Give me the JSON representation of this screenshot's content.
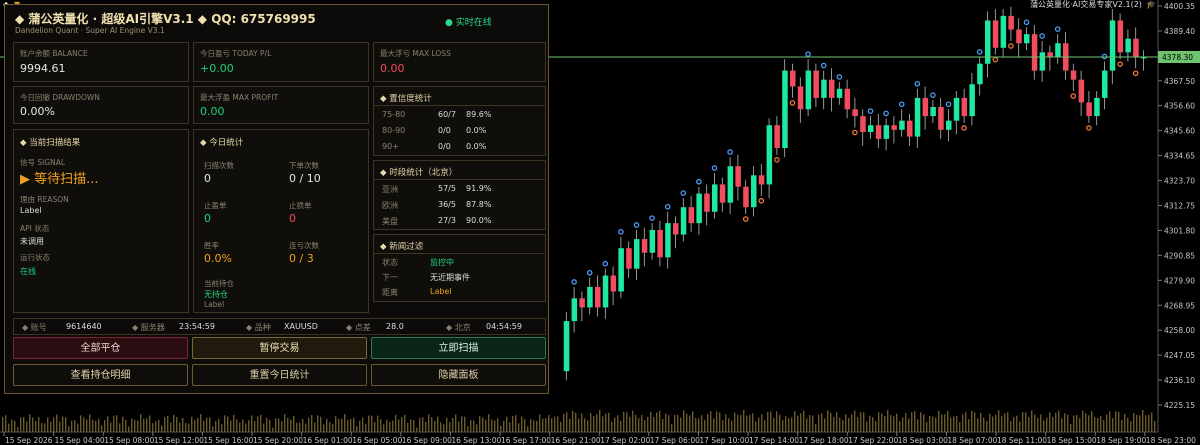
{
  "toolbar": {
    "icon1": "◆",
    "icon2": "🔒",
    "icon3": "▼",
    "icon4": "▣",
    "right_label": "蒲公英量化·AI交易专家V2.1(2)",
    "right_icon": "🎓"
  },
  "chart": {
    "price_labels": [
      "4400.35",
      "4389.40",
      "4378.30",
      "4367.50",
      "4356.60",
      "4345.60",
      "4334.65",
      "4323.70",
      "4312.75",
      "4301.80",
      "4290.85",
      "4279.90",
      "4268.95",
      "4258.00",
      "4247.05",
      "4236.10",
      "4225.15"
    ],
    "current_price": "4378.30",
    "time_labels": [
      "15 Sep 2026",
      "15 Sep 04:00",
      "15 Sep 08:00",
      "15 Sep 12:00",
      "15 Sep 16:00",
      "15 Sep 20:00",
      "16 Sep 01:00",
      "16 Sep 05:00",
      "16 Sep 09:00",
      "16 Sep 13:00",
      "16 Sep 17:00",
      "16 Sep 21:00",
      "17 Sep 02:00",
      "17 Sep 06:00",
      "17 Sep 10:00",
      "17 Sep 14:00",
      "17 Sep 18:00",
      "17 Sep 22:00",
      "18 Sep 03:00",
      "18 Sep 07:00",
      "18 Sep 11:00",
      "18 Sep 15:00",
      "18 Sep 19:00",
      "18 Sep 23:00"
    ],
    "colors": {
      "bull": "#1de9a0",
      "bear": "#f24d5e",
      "price_line": "#6fc36f",
      "axis_text": "#c8c8c8"
    }
  },
  "panel": {
    "title": "◆ 蒲公英量化 · 超级AI引擎V3.1 ◆    QQ:  675769995",
    "subtitle": "Dandelion Quant · Super AI Engine V3.1",
    "live": "● 实时在线",
    "stats": [
      {
        "label": "账户余额 BALANCE",
        "value": "9994.61",
        "color": "white"
      },
      {
        "label": "今日盈亏 TODAY P/L",
        "value": "+0.00",
        "color": "green"
      },
      {
        "label": "最大浮亏 MAX LOSS",
        "value": "0.00",
        "color": "red"
      },
      {
        "label": "今日回撤 DRAWDOWN",
        "value": "0.00%",
        "color": "white"
      },
      {
        "label": "最大浮盈 MAX PROFIT",
        "value": "0.00",
        "color": "green"
      }
    ],
    "scan": {
      "title": "◆ 当前扫描结果",
      "signal_label": "信号 SIGNAL",
      "signal_value": "▶  等待扫描...",
      "reason_label": "理由 REASON",
      "reason_value": "Label",
      "api_label": "API 状态",
      "api_value": "未调用",
      "run_label": "运行状态",
      "run_value": "在线"
    },
    "today": {
      "title": "◆ 今日统计",
      "scan_count_label": "扫描次数",
      "scan_count": "0",
      "order_count_label": "下单次数",
      "order_count": "0 / 10",
      "tp_label": "止盈单",
      "tp": "0",
      "sl_label": "止损单",
      "sl": "0",
      "winrate_label": "胜率",
      "winrate": "0.0%",
      "consec_label": "连亏次数",
      "consec": "0 / 3",
      "position_label": "当前持仓",
      "position": "无持仓",
      "position_sub": "Label"
    },
    "confidence": {
      "title": "◆ 置信度统计",
      "rows": [
        {
          "range": "75-80",
          "count": "60/7",
          "rate": "89.6%"
        },
        {
          "range": "80-90",
          "count": "0/0",
          "rate": "0.0%"
        },
        {
          "range": "90+",
          "count": "0/0",
          "rate": "0.0%"
        }
      ]
    },
    "session": {
      "title": "◆ 时段统计（北京）",
      "rows": [
        {
          "name": "亚洲",
          "count": "57/5",
          "rate": "91.9%"
        },
        {
          "name": "欧洲",
          "count": "36/5",
          "rate": "87.8%"
        },
        {
          "name": "美盘",
          "count": "27/3",
          "rate": "90.0%"
        }
      ]
    },
    "news": {
      "title": "◆ 新闻过滤",
      "status_label": "状态",
      "status": "监控中",
      "next_label": "下一",
      "next": "无近期事件",
      "dist_label": "距离",
      "dist": "Label"
    },
    "info": {
      "account_label": "◆ 账号",
      "account": "9614640",
      "server_label": "◆ 服务器",
      "server": "23:54:59",
      "symbol_label": "◆ 品种",
      "symbol": "XAUUSD",
      "spread_label": "◆ 点差",
      "spread": "28.0",
      "bj_label": "◆ 北京",
      "bj": "04:54:59"
    },
    "buttons": {
      "close_all": "全部平仓",
      "pause": "暂停交易",
      "scan_now": "立即扫描",
      "view_positions": "查看持仓明细",
      "reset_stats": "重置今日统计",
      "hide_panel": "隐藏面板"
    }
  }
}
